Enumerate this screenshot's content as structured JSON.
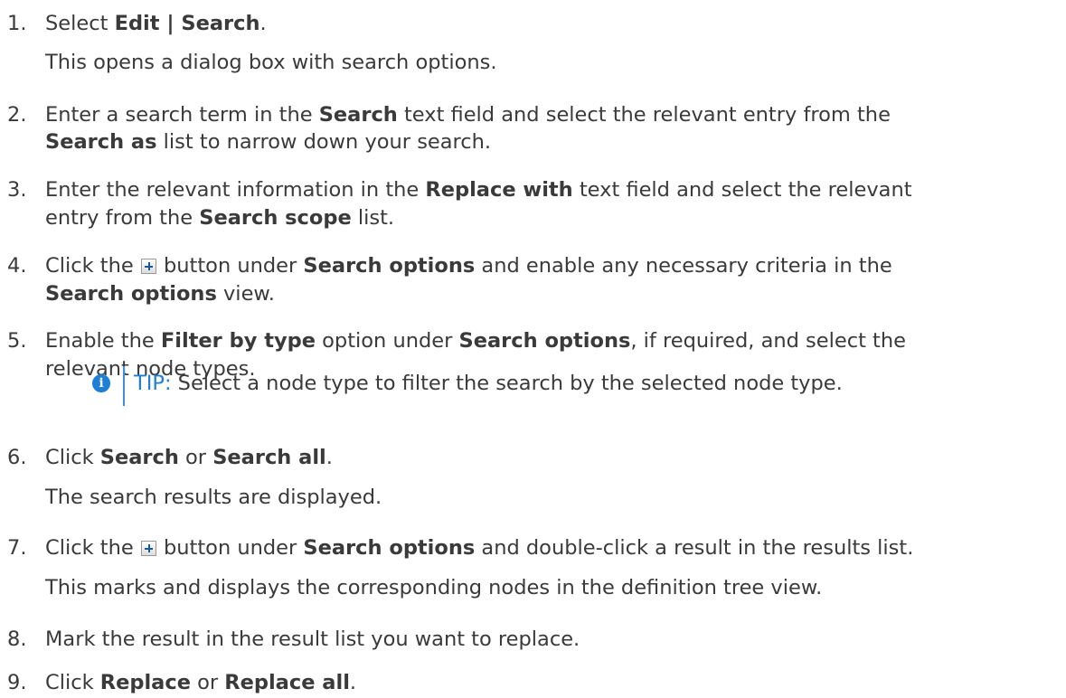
{
  "steps": [
    {
      "num": "1.",
      "lines": [
        [
          "Select ",
          {
            "b": "Edit | Search"
          },
          "."
        ]
      ],
      "note": "This opens a dialog box with search options."
    },
    {
      "num": "2.",
      "lines": [
        [
          "Enter a search term in the ",
          {
            "b": "Search"
          },
          " text field and select the relevant entry from the"
        ],
        [
          {
            "b": "Search as"
          },
          " list to narrow down your search."
        ]
      ]
    },
    {
      "num": "3.",
      "lines": [
        [
          "Enter the relevant information in the ",
          {
            "b": "Replace with"
          },
          " text field and select the relevant"
        ],
        [
          "entry from the ",
          {
            "b": "Search scope"
          },
          " list."
        ]
      ]
    },
    {
      "num": "4.",
      "lines": [
        [
          "Click the ",
          {
            "icon": "plus-icon"
          },
          " button under ",
          {
            "b": "Search options"
          },
          " and enable any necessary criteria in the"
        ],
        [
          {
            "b": "Search options"
          },
          " view."
        ]
      ]
    },
    {
      "num": "5.",
      "lines": [
        [
          "Enable the ",
          {
            "b": "Filter by type"
          },
          " option under ",
          {
            "b": "Search options"
          },
          ", if required, and select the"
        ],
        [
          "relevant node types."
        ]
      ]
    },
    {
      "num": "6.",
      "lines": [
        [
          "Click ",
          {
            "b": "Search"
          },
          " or ",
          {
            "b": "Search all"
          },
          "."
        ]
      ],
      "note": "The search results are displayed."
    },
    {
      "num": "7.",
      "lines": [
        [
          "Click the ",
          {
            "icon": "plus-icon"
          },
          " button under ",
          {
            "b": "Search options"
          },
          " and double-click a result in the results list."
        ]
      ],
      "note": "This marks and displays the corresponding nodes in the definition tree view."
    },
    {
      "num": "8.",
      "lines": [
        [
          "Mark the result in the result list you want to replace."
        ]
      ]
    },
    {
      "num": "9.",
      "lines": [
        [
          "Click ",
          {
            "b": "Replace"
          },
          " or ",
          {
            "b": "Replace all"
          },
          "."
        ]
      ]
    }
  ],
  "tip": {
    "label": "TIP:",
    "text": " Select a node type to filter the search by the selected node type.",
    "icon": "info-icon"
  }
}
